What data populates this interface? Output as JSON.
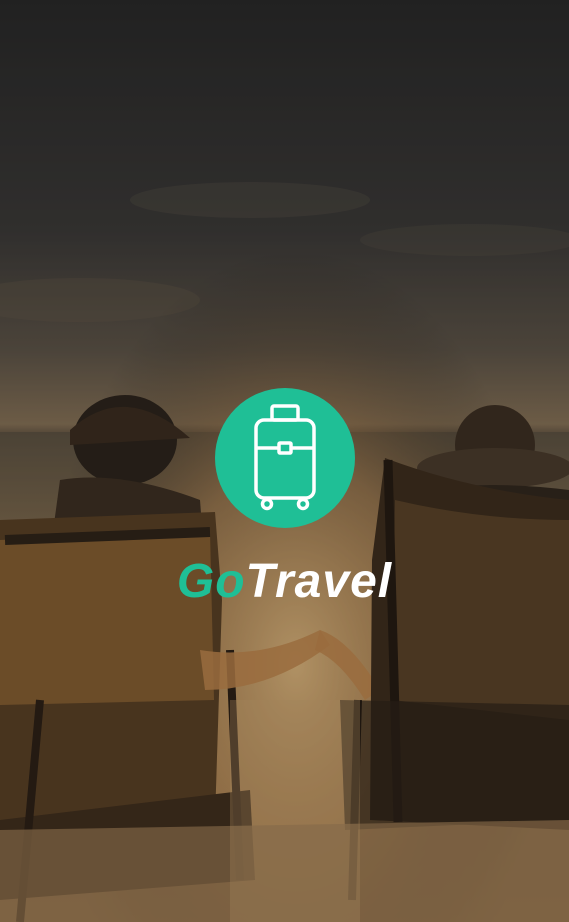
{
  "app": {
    "brand_go": "Go",
    "brand_travel": "Travel"
  },
  "icons": {
    "logo": "suitcase-icon"
  },
  "colors": {
    "accent": "#1fbf96",
    "text_white": "#ffffff",
    "sky_top": "#2a2a2a",
    "horizon_glow": "#c9a571",
    "sand": "#d8b27a"
  }
}
